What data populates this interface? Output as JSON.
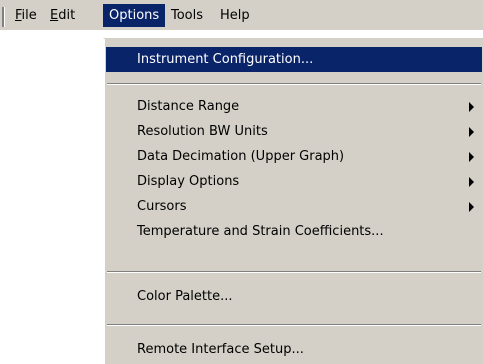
{
  "menubar": {
    "items": [
      {
        "mnemonic": "F",
        "rest": "ile"
      },
      {
        "mnemonic": "E",
        "rest": "dit"
      },
      {
        "mnemonic": "",
        "rest": "Options"
      },
      {
        "mnemonic": "",
        "rest": "Tools"
      },
      {
        "mnemonic": "",
        "rest": "Help"
      }
    ],
    "active": "Options"
  },
  "options_menu": {
    "items": [
      {
        "label": "Instrument Configuration...",
        "submenu": false,
        "highlighted": true
      },
      {
        "label": "Distance Range",
        "submenu": true
      },
      {
        "label": "Resolution BW Units",
        "submenu": true
      },
      {
        "label": "Data Decimation (Upper Graph)",
        "submenu": true
      },
      {
        "label": "Display Options",
        "submenu": true
      },
      {
        "label": "Cursors",
        "submenu": true
      },
      {
        "label": "Temperature and Strain Coefficients...",
        "submenu": false
      },
      {
        "label": "Color Palette...",
        "submenu": false
      },
      {
        "label": "Remote Interface Setup...",
        "submenu": false
      }
    ]
  },
  "icons": {
    "submenu_arrow": "triangle-right-icon"
  }
}
